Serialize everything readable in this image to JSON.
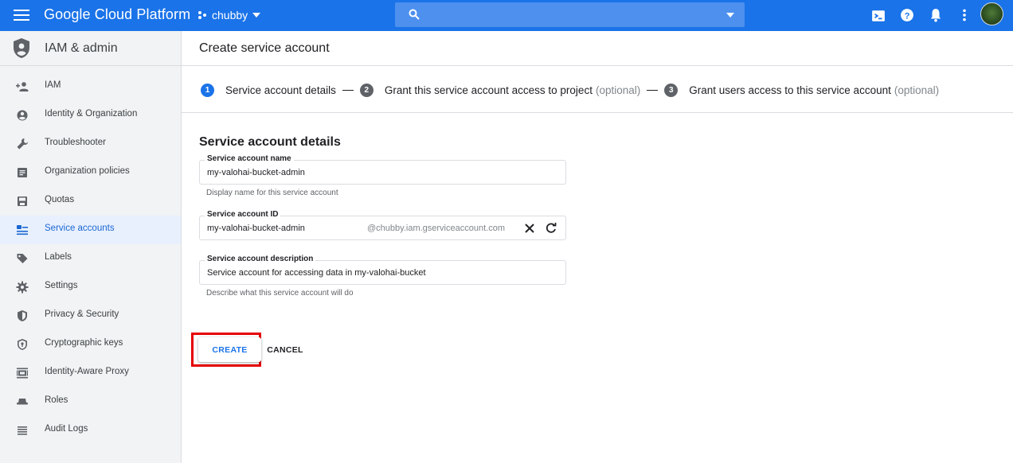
{
  "topbar": {
    "brand": "Google Cloud Platform",
    "project": "chubby",
    "search_placeholder": "",
    "icons": [
      "menu-icon",
      "project-icon",
      "search-icon",
      "cloud-shell-icon",
      "help-icon",
      "notifications-icon",
      "more-vert-icon",
      "avatar"
    ],
    "color": "#1a73e8"
  },
  "sidebar": {
    "title": "IAM & admin",
    "items": [
      {
        "label": "IAM",
        "icon": "add-person-icon",
        "active": false
      },
      {
        "label": "Identity & Organization",
        "icon": "account-circle-icon",
        "active": false
      },
      {
        "label": "Troubleshooter",
        "icon": "wrench-icon",
        "active": false
      },
      {
        "label": "Organization policies",
        "icon": "document-icon",
        "active": false
      },
      {
        "label": "Quotas",
        "icon": "save-disk-icon",
        "active": false
      },
      {
        "label": "Service accounts",
        "icon": "service-account-icon",
        "active": true
      },
      {
        "label": "Labels",
        "icon": "label-icon",
        "active": false
      },
      {
        "label": "Settings",
        "icon": "gear-icon",
        "active": false
      },
      {
        "label": "Privacy & Security",
        "icon": "shield-icon",
        "active": false
      },
      {
        "label": "Cryptographic keys",
        "icon": "key-shield-icon",
        "active": false
      },
      {
        "label": "Identity-Aware Proxy",
        "icon": "proxy-icon",
        "active": false
      },
      {
        "label": "Roles",
        "icon": "roles-icon",
        "active": false
      },
      {
        "label": "Audit Logs",
        "icon": "list-icon",
        "active": false
      }
    ]
  },
  "main": {
    "page_title": "Create service account",
    "steps": [
      {
        "num": "1",
        "label": "Service account details",
        "optional": ""
      },
      {
        "num": "2",
        "label": "Grant this service account access to project",
        "optional": "(optional)"
      },
      {
        "num": "3",
        "label": "Grant users access to this service account",
        "optional": "(optional)"
      }
    ],
    "section_title": "Service account details",
    "fields": {
      "name": {
        "label": "Service account name",
        "value": "my-valohai-bucket-admin",
        "helper": "Display name for this service account"
      },
      "id": {
        "label": "Service account ID",
        "value": "my-valohai-bucket-admin",
        "suffix": "@chubby.iam.gserviceaccount.com"
      },
      "description": {
        "label": "Service account description",
        "value": "Service account for accessing data in my-valohai-bucket",
        "helper": "Describe what this service account will do"
      }
    },
    "buttons": {
      "create": "CREATE",
      "cancel": "CANCEL"
    },
    "highlight_color": "#e60000"
  }
}
